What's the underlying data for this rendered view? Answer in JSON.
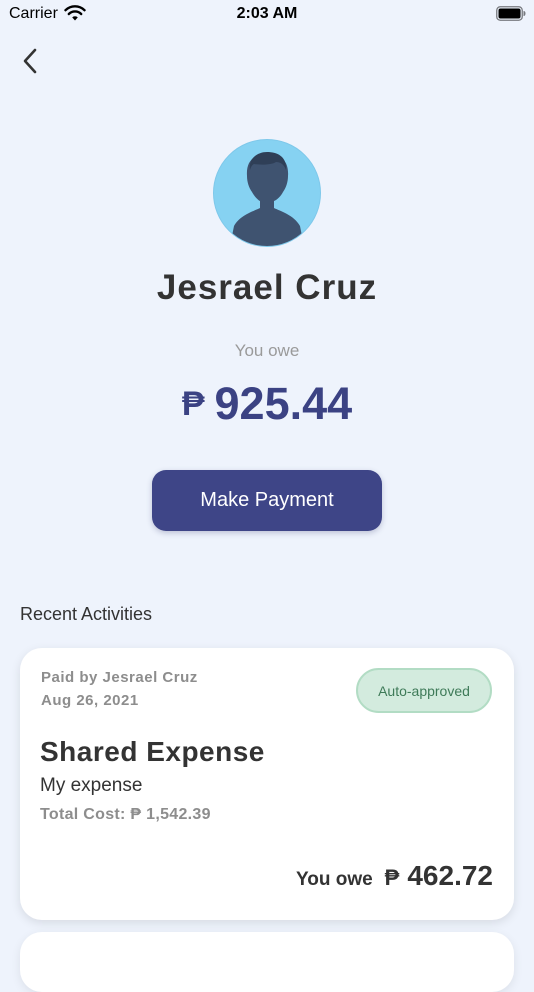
{
  "status_bar": {
    "carrier": "Carrier",
    "time": "2:03 AM"
  },
  "nav": {
    "back_icon": "chevron-left-icon"
  },
  "profile": {
    "avatar_icon": "person-silhouette-icon",
    "name": "Jesrael Cruz",
    "owe_label": "You owe",
    "currency": "₱",
    "amount": "925.44"
  },
  "actions": {
    "make_payment_label": "Make Payment"
  },
  "recent": {
    "title": "Recent Activities",
    "activities": [
      {
        "paid_by": "Paid by Jesrael Cruz",
        "date": "Aug 26, 2021",
        "status": "Auto-approved",
        "title": "Shared Expense",
        "description": "My expense",
        "total_cost": "Total Cost: ₱ 1,542.39",
        "you_owe_label": "You owe",
        "currency": "₱",
        "you_owe_amount": "462.72"
      }
    ]
  },
  "colors": {
    "background": "#eef3fc",
    "accent": "#3e4587",
    "amount": "#3b4283",
    "badge_bg": "#d3ebde",
    "badge_text": "#3e7a58"
  }
}
